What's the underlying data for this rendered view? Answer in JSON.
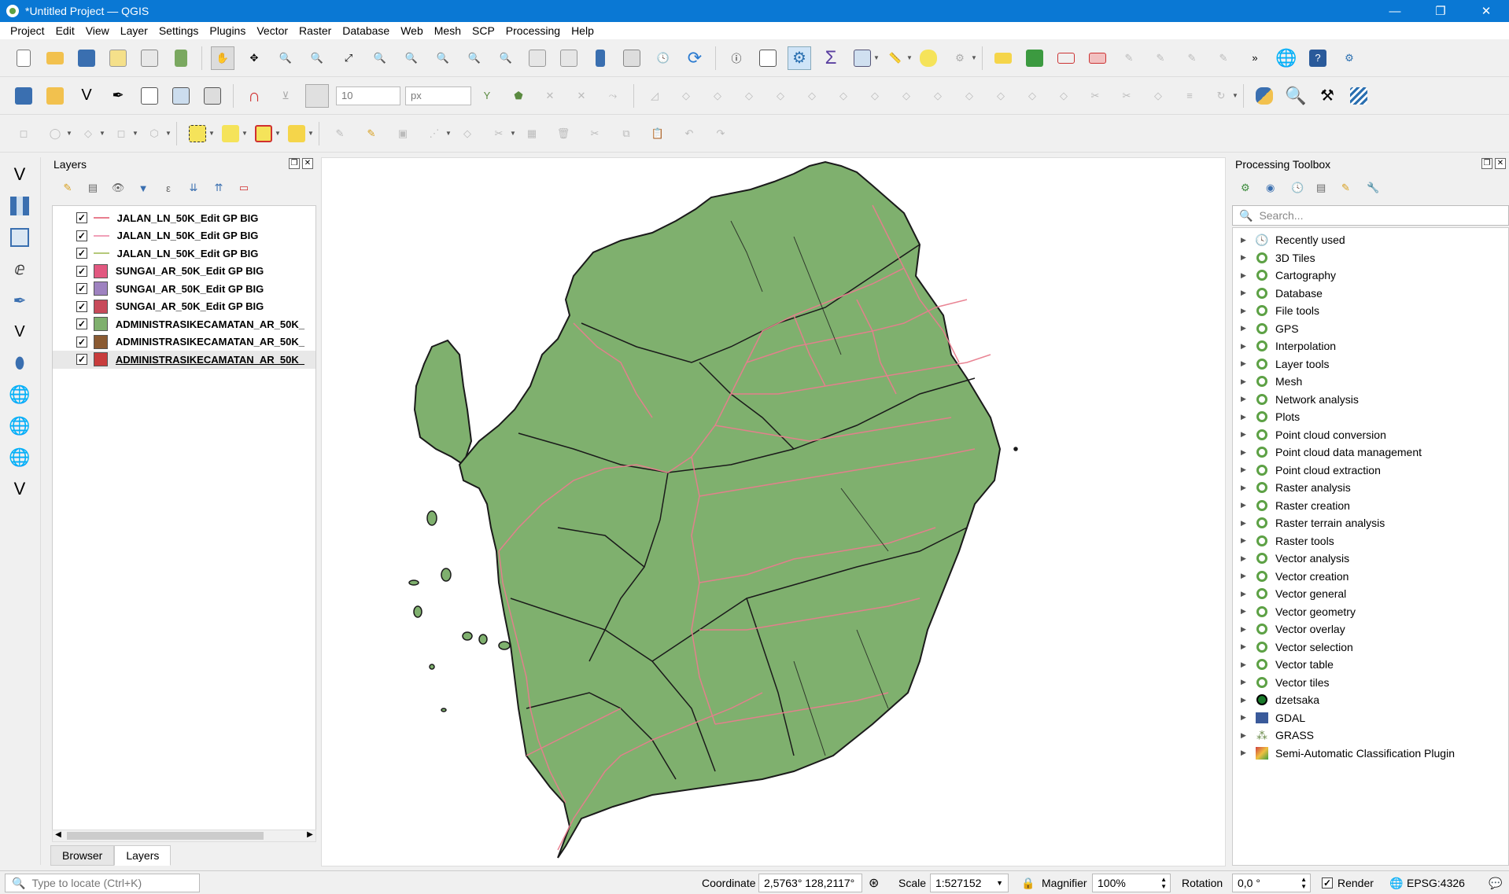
{
  "window": {
    "title": "*Untitled Project — QGIS",
    "minimize": "—",
    "maximize": "❐",
    "close": "✕"
  },
  "menu": [
    "Project",
    "Edit",
    "View",
    "Layer",
    "Settings",
    "Plugins",
    "Vector",
    "Raster",
    "Database",
    "Web",
    "Mesh",
    "SCP",
    "Processing",
    "Help"
  ],
  "toolbar2": {
    "size_value": "10",
    "unit_value": "px"
  },
  "layers_panel": {
    "title": "Layers",
    "layers": [
      {
        "name": "JALAN_LN_50K_Edit GP BIG",
        "type": "line",
        "color": "#e87e8e",
        "checked": "✓"
      },
      {
        "name": "JALAN_LN_50K_Edit GP BIG",
        "type": "line",
        "color": "#f0a0b8",
        "checked": "✓"
      },
      {
        "name": "JALAN_LN_50K_Edit GP BIG",
        "type": "line",
        "color": "#b5c97a",
        "checked": "✓"
      },
      {
        "name": "SUNGAI_AR_50K_Edit GP BIG",
        "type": "fill",
        "color": "#e25880",
        "checked": "✓"
      },
      {
        "name": "SUNGAI_AR_50K_Edit GP BIG",
        "type": "fill",
        "color": "#9e82c0",
        "checked": "✓"
      },
      {
        "name": "SUNGAI_AR_50K_Edit GP BIG",
        "type": "fill",
        "color": "#c84a5a",
        "checked": "✓"
      },
      {
        "name": "ADMINISTRASIKECAMATAN_AR_50K_",
        "type": "fill",
        "color": "#7fb06e",
        "checked": "✓"
      },
      {
        "name": "ADMINISTRASIKECAMATAN_AR_50K_",
        "type": "fill",
        "color": "#8a5a32",
        "checked": "✓"
      },
      {
        "name": "ADMINISTRASIKECAMATAN_AR_50K_",
        "type": "fill",
        "color": "#c83c3c",
        "checked": "✓"
      }
    ],
    "tabs": [
      "Browser",
      "Layers"
    ]
  },
  "processing": {
    "title": "Processing Toolbox",
    "search_placeholder": "Search...",
    "items": [
      {
        "label": "Recently used",
        "icon": "clock-icon"
      },
      {
        "label": "3D Tiles",
        "icon": "qgis-icon"
      },
      {
        "label": "Cartography",
        "icon": "qgis-icon"
      },
      {
        "label": "Database",
        "icon": "qgis-icon"
      },
      {
        "label": "File tools",
        "icon": "qgis-icon"
      },
      {
        "label": "GPS",
        "icon": "qgis-icon"
      },
      {
        "label": "Interpolation",
        "icon": "qgis-icon"
      },
      {
        "label": "Layer tools",
        "icon": "qgis-icon"
      },
      {
        "label": "Mesh",
        "icon": "qgis-icon"
      },
      {
        "label": "Network analysis",
        "icon": "qgis-icon"
      },
      {
        "label": "Plots",
        "icon": "qgis-icon"
      },
      {
        "label": "Point cloud conversion",
        "icon": "qgis-icon"
      },
      {
        "label": "Point cloud data management",
        "icon": "qgis-icon"
      },
      {
        "label": "Point cloud extraction",
        "icon": "qgis-icon"
      },
      {
        "label": "Raster analysis",
        "icon": "qgis-icon"
      },
      {
        "label": "Raster creation",
        "icon": "qgis-icon"
      },
      {
        "label": "Raster terrain analysis",
        "icon": "qgis-icon"
      },
      {
        "label": "Raster tools",
        "icon": "qgis-icon"
      },
      {
        "label": "Vector analysis",
        "icon": "qgis-icon"
      },
      {
        "label": "Vector creation",
        "icon": "qgis-icon"
      },
      {
        "label": "Vector general",
        "icon": "qgis-icon"
      },
      {
        "label": "Vector geometry",
        "icon": "qgis-icon"
      },
      {
        "label": "Vector overlay",
        "icon": "qgis-icon"
      },
      {
        "label": "Vector selection",
        "icon": "qgis-icon"
      },
      {
        "label": "Vector table",
        "icon": "qgis-icon"
      },
      {
        "label": "Vector tiles",
        "icon": "qgis-icon"
      },
      {
        "label": "dzetsaka",
        "icon": "dzetsaka-icon"
      },
      {
        "label": "GDAL",
        "icon": "gdal-icon"
      },
      {
        "label": "GRASS",
        "icon": "grass-icon"
      },
      {
        "label": "Semi-Automatic Classification Plugin",
        "icon": "scp-icon"
      }
    ]
  },
  "status": {
    "locate_placeholder": "Type to locate (Ctrl+K)",
    "coordinate_label": "Coordinate",
    "coordinate_value": "2,5763° 128,2117°",
    "scale_label": "Scale",
    "scale_value": "1:527152",
    "magnifier_label": "Magnifier",
    "magnifier_value": "100%",
    "rotation_label": "Rotation",
    "rotation_value": "0,0 °",
    "render_label": "Render",
    "render_checked": "✓",
    "crs": "EPSG:4326"
  },
  "colors": {
    "titlebar": "#0a78d4",
    "land": "#7fb06e",
    "road": "#e87e8e",
    "qgis_green": "#5da145"
  }
}
